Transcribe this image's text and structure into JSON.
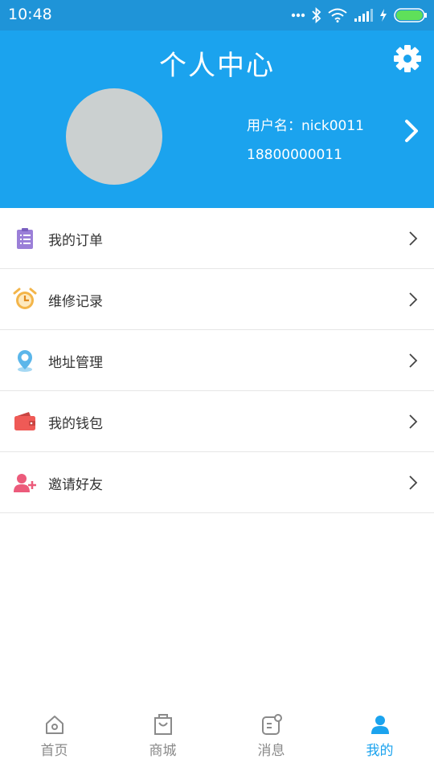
{
  "status_bar": {
    "time": "10:48"
  },
  "header": {
    "title": "个人中心",
    "username": "用户名：nick0011",
    "phone": "18800000011"
  },
  "menu": [
    {
      "label": "我的订单",
      "icon": "clipboard-icon",
      "color": "#9b7fd8"
    },
    {
      "label": "维修记录",
      "icon": "alarm-clock-icon",
      "color": "#f3b54a"
    },
    {
      "label": "地址管理",
      "icon": "location-pin-icon",
      "color": "#5bb6ea"
    },
    {
      "label": "我的钱包",
      "icon": "wallet-icon",
      "color": "#ef5a56"
    },
    {
      "label": "邀请好友",
      "icon": "add-user-icon",
      "color": "#ec5b7b"
    }
  ],
  "tabs": [
    {
      "label": "首页",
      "icon": "home-icon"
    },
    {
      "label": "商城",
      "icon": "shopping-bag-icon"
    },
    {
      "label": "消息",
      "icon": "message-icon"
    },
    {
      "label": "我的",
      "icon": "person-icon",
      "active": true
    }
  ],
  "colors": {
    "header_bg": "#1ba3ee",
    "status_bg": "#1f94d8",
    "active_tab": "#1ba3ee",
    "inactive_tab": "#8a8a8a"
  }
}
